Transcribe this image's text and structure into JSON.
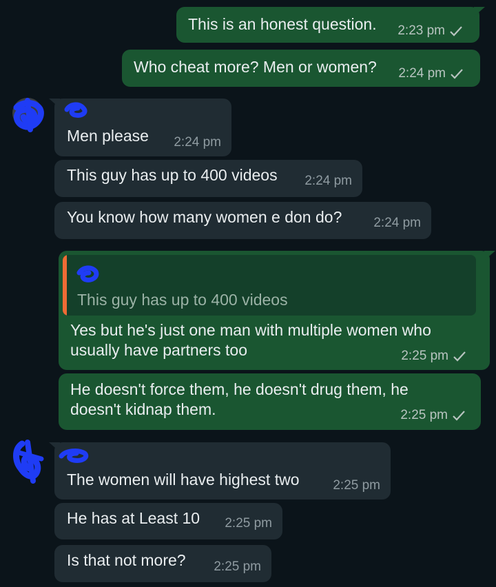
{
  "messages": {
    "m1": {
      "text": "This is an honest question.",
      "time": "2:23 pm"
    },
    "m2": {
      "text": "Who cheat more? Men or women?",
      "time": "2:24 pm"
    },
    "m3": {
      "text": "Men please",
      "time": "2:24 pm"
    },
    "m4": {
      "text": "This guy has up to 400 videos",
      "time": "2:24 pm"
    },
    "m5": {
      "text": "You know how many women e don do?",
      "time": "2:24 pm"
    },
    "m6": {
      "quote": "This guy has up to 400 videos",
      "text": "Yes but he's just one man with multiple women who usually have partners too",
      "time": "2:25 pm"
    },
    "m7": {
      "text": "He doesn't force them, he doesn't drug them, he doesn't kidnap them.",
      "time": "2:25 pm"
    },
    "m8": {
      "text": "The women will have highest two",
      "time": "2:25 pm"
    },
    "m9": {
      "text": "He has at Least 10",
      "time": "2:25 pm"
    },
    "m10": {
      "text": "Is that not more?",
      "time": "2:25 pm"
    }
  },
  "colors": {
    "background": "#0b141a",
    "outgoing_bubble": "#1a5631",
    "incoming_bubble": "#202c33",
    "quote_bar": "#ef6b35",
    "redaction_scribble": "#1f3cf5"
  },
  "icons": {
    "sent_tick": "check-icon",
    "avatar": "avatar-redacted",
    "sender_name": "name-redacted"
  }
}
